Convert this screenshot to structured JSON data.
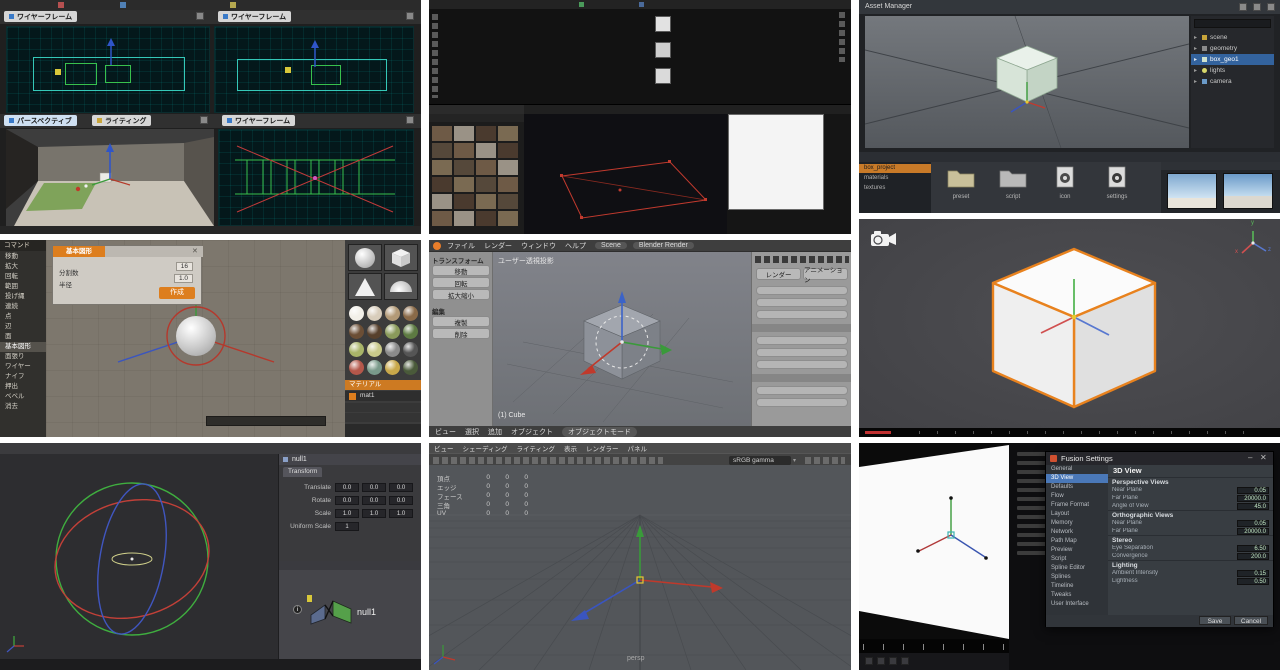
{
  "c1": {
    "tabs": {
      "tl": "ワイヤーフレーム",
      "tr": "ワイヤーフレーム",
      "bl1": "パースペクティブ",
      "bl2": "ライティング",
      "br": "ワイヤーフレーム"
    }
  },
  "c3": {
    "title": "Asset Manager",
    "outliner": {
      "items": [
        "scene",
        "geometry",
        "box_geo1",
        "lights",
        "camera"
      ]
    },
    "assets": {
      "list": [
        "box_project",
        "materials",
        "textures"
      ],
      "items": [
        "preset",
        "script",
        "icon",
        "settings"
      ]
    }
  },
  "c4": {
    "panel_title": "コマンド",
    "commands": [
      "移動",
      "拡大",
      "回転",
      "範囲",
      "投げ縄",
      "連続",
      "点",
      "辺",
      "面",
      "基本図形",
      "面張り",
      "ワイヤー",
      "ナイフ",
      "押出",
      "ベベル",
      "消去"
    ],
    "dialog": {
      "title": "基本図形",
      "rows": [
        {
          "l": "分割数",
          "v": "16"
        },
        {
          "l": "半径",
          "v": "1.0"
        }
      ],
      "button": "作成"
    },
    "material_header": "マテリアル",
    "material_item": "mat1"
  },
  "c5": {
    "menus": [
      "ファイル",
      "レンダー",
      "ウィンドウ",
      "ヘルプ"
    ],
    "scene": "Scene",
    "engine": "Blender Render",
    "shelf": {
      "h1": "トランスフォーム",
      "b": [
        "移動",
        "回転",
        "拡大縮小"
      ],
      "h2": "編集",
      "b2": [
        "複製",
        "削除"
      ]
    },
    "viewport_label": "ユーザー透視投影",
    "object_label": "(1) Cube",
    "bottom_menus": [
      "ビュー",
      "選択",
      "追加",
      "オブジェクト"
    ],
    "mode": "オブジェクトモード",
    "props": {
      "b1": "レンダー",
      "b2": "アニメーション"
    }
  },
  "c6": {
    "axis": {
      "x": "x",
      "y": "y",
      "z": "z"
    }
  },
  "c7": {
    "node": "null1",
    "tab": "Transform",
    "params": [
      {
        "l": "Translate",
        "v": [
          "0.0",
          "0.0",
          "0.0"
        ]
      },
      {
        "l": "Rotate",
        "v": [
          "0.0",
          "0.0",
          "0.0"
        ]
      },
      {
        "l": "Scale",
        "v": [
          "1.0",
          "1.0",
          "1.0"
        ]
      }
    ],
    "uniform": {
      "l": "Uniform Scale",
      "v": "1"
    },
    "badge": "i",
    "node_label": "null1"
  },
  "c8": {
    "menus": [
      "ビュー",
      "シェーディング",
      "ライティング",
      "表示",
      "レンダラー",
      "パネル"
    ],
    "colorspace": "sRGB gamma",
    "hud": [
      {
        "l": "頂点",
        "v": [
          "0",
          "0",
          "0"
        ]
      },
      {
        "l": "エッジ",
        "v": [
          "0",
          "0",
          "0"
        ]
      },
      {
        "l": "フェース",
        "v": [
          "0",
          "0",
          "0"
        ]
      },
      {
        "l": "三角",
        "v": [
          "0",
          "0",
          "0"
        ]
      },
      {
        "l": "UV",
        "v": [
          "0",
          "0",
          "0"
        ]
      }
    ],
    "camera_label": "persp"
  },
  "c9": {
    "dialog": {
      "title": "Fusion Settings",
      "content_title": "3D View",
      "sidebar": [
        "General",
        "3D View",
        "Defaults",
        "Flow",
        "Frame Format",
        "Layout",
        "Memory",
        "Network",
        "Path Map",
        "Preview",
        "Script",
        "Spline Editor",
        "Splines",
        "Timeline",
        "Tweaks",
        "User Interface"
      ],
      "sections": [
        {
          "h": "Perspective Views",
          "rows": [
            {
              "l": "Near Plane",
              "v": "0.05"
            },
            {
              "l": "Far Plane",
              "v": "20000.0"
            },
            {
              "l": "Angle of View",
              "v": "45.0"
            }
          ]
        },
        {
          "h": "Orthographic Views",
          "rows": [
            {
              "l": "Near Plane",
              "v": "0.05"
            },
            {
              "l": "Far Plane",
              "v": "20000.0"
            }
          ]
        },
        {
          "h": "Stereo",
          "rows": [
            {
              "l": "Eye Separation",
              "v": "6.50"
            },
            {
              "l": "Convergence",
              "v": "200.0"
            }
          ]
        },
        {
          "h": "Lighting",
          "rows": [
            {
              "l": "Ambient Intensity",
              "v": "0.15"
            },
            {
              "l": "Lightness",
              "v": "0.50"
            }
          ]
        }
      ],
      "footer_buttons": [
        "Save",
        "Cancel"
      ]
    }
  }
}
